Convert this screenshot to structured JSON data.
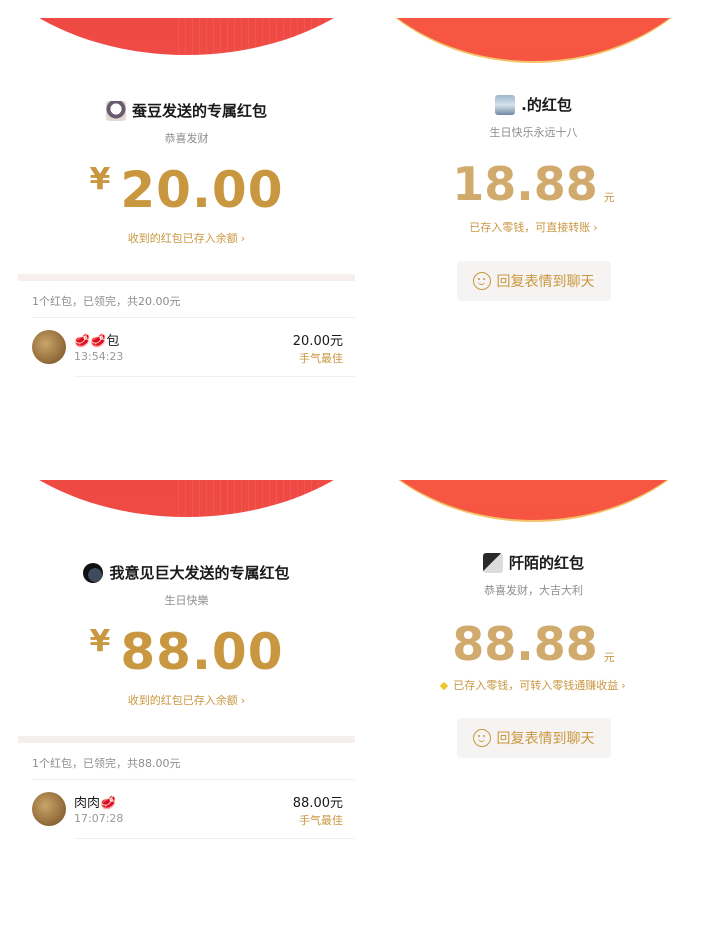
{
  "colors": {
    "red_header": "#f0453f",
    "orange_header": "#f95a46",
    "gold": "#c9973f",
    "gray_text": "#8e8e8e"
  },
  "panel_a": {
    "title": "蚕豆发送的专属红包",
    "subtitle": "恭喜发财",
    "yen": "¥",
    "amount": "20.00",
    "note": "收到的红包已存入余额",
    "summary": "1个红包，已领完，共20.00元",
    "record": {
      "name": "🥩🥩包",
      "time": "13:54:23",
      "amount": "20.00元",
      "badge": "手气最佳"
    }
  },
  "panel_b": {
    "title": ".的红包",
    "subtitle": "生日快乐永远十八",
    "amount": "18.88",
    "unit": "元",
    "note": "已存入零钱，可直接转账",
    "reply_label": "回复表情到聊天"
  },
  "panel_c": {
    "title": "我意见巨大发送的专属红包",
    "subtitle": "生日快樂",
    "yen": "¥",
    "amount": "88.00",
    "note": "收到的红包已存入余额",
    "summary": "1个红包，已领完，共88.00元",
    "record": {
      "name": "肉肉🥩",
      "time": "17:07:28",
      "amount": "88.00元",
      "badge": "手气最佳"
    }
  },
  "panel_d": {
    "title": "阡陌的红包",
    "subtitle": "恭喜发财，大吉大利",
    "amount": "88.88",
    "unit": "元",
    "note": "已存入零钱，可转入零钱通赚收益",
    "reply_label": "回复表情到聊天"
  },
  "icons": {
    "chevron": "chevron-right-icon",
    "smile": "smile-icon",
    "diamond": "diamond-icon"
  }
}
